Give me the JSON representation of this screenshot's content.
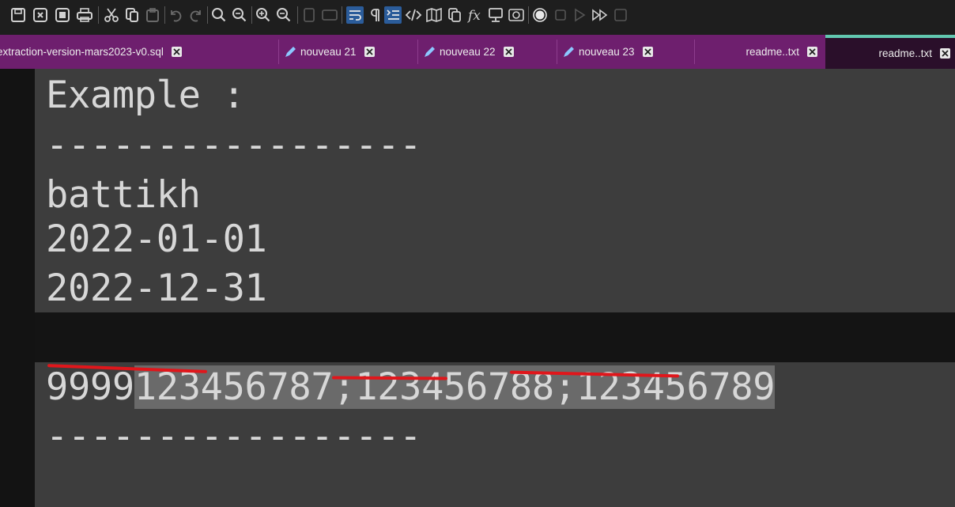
{
  "toolbar": {
    "icons": [
      "save-icon",
      "close-file-icon",
      "close-all-icon",
      "print-icon",
      "cut-icon",
      "copy-icon",
      "paste-icon",
      "undo-icon",
      "redo-icon",
      "find-icon",
      "replace-icon",
      "zoom-in-icon",
      "zoom-out-icon",
      "sync-v-icon",
      "sync-h-icon",
      "word-wrap-icon",
      "show-all-chars-icon",
      "indent-guide-icon",
      "xml-tag-icon",
      "document-map-icon",
      "document-list-icon",
      "function-list-icon",
      "folder-workspace-icon",
      "monitoring-icon",
      "record-macro-icon",
      "stop-macro-icon",
      "play-macro-icon",
      "run-macro-multiple-icon",
      "save-macro-icon"
    ]
  },
  "tabs": [
    {
      "label": "extraction-version-mars2023-v0.sql",
      "modified": false
    },
    {
      "label": "nouveau 21",
      "modified": true
    },
    {
      "label": "nouveau 22",
      "modified": true
    },
    {
      "label": "nouveau 23",
      "modified": true
    },
    {
      "label": "readme..txt",
      "modified": false
    },
    {
      "label": "readme..txt",
      "modified": false,
      "active": true
    }
  ],
  "editor": {
    "lines": [
      "Example :",
      "-----------------",
      "battikh",
      "2022-01-01",
      "2022-12-31",
      "123456787;123456788;123456789",
      "9999",
      "-----------------"
    ],
    "selected_line_index": 5
  },
  "colors": {
    "tab_bar": "#6e1f6e",
    "active_tab": "#2a0f2a",
    "active_tab_accent": "#62c8b0",
    "editor_bg": "#3d3d3d",
    "annotation": "#e0161b"
  }
}
